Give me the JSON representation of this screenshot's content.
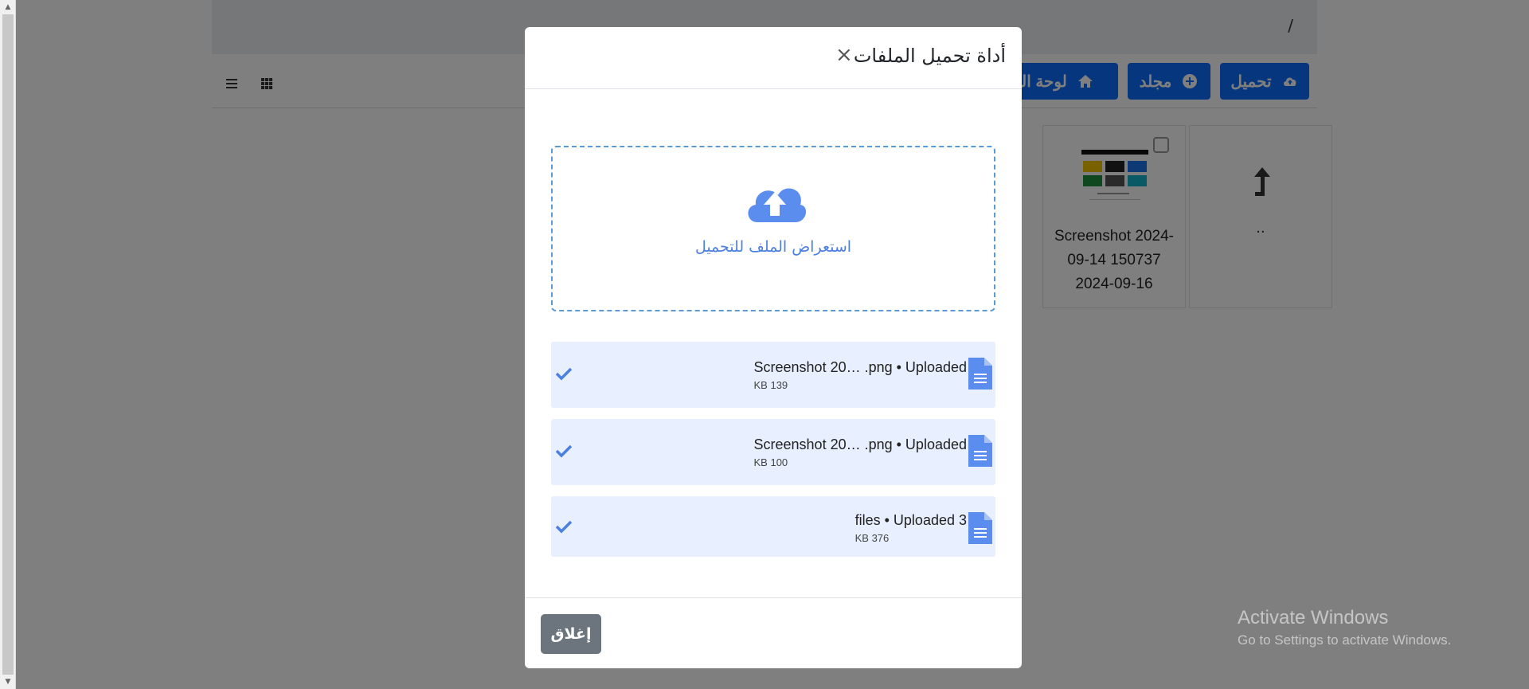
{
  "breadcrumb": {
    "separator": "/"
  },
  "toolbar": {
    "upload_label": "تحميل",
    "folder_label": "مجلد",
    "dashboard_label": "لوحة التح"
  },
  "grid": {
    "parent_label": "..",
    "file_name_line1": "Screenshot 2024-",
    "file_name_line2": "09-14 150737",
    "file_date": "2024-09-16"
  },
  "modal": {
    "title": "أداة تحميل الملفات",
    "close_x": "×",
    "dropzone_label": "استعراض الملف للتحميل",
    "files": [
      {
        "name": "Screenshot 20… .png • Uploaded",
        "size": "KB 139"
      },
      {
        "name": "Screenshot 20… .png • Uploaded",
        "size": "KB 100"
      },
      {
        "name": "files • Uploaded 3",
        "size": "KB 376"
      }
    ],
    "close_button": "إغلاق"
  },
  "watermark": {
    "line1": "Activate Windows",
    "line2": "Go to Settings to activate Windows."
  },
  "colors": {
    "primary": "#0d6efd",
    "secondary": "#6c757d",
    "dropzone_accent": "#4b7fe0",
    "file_row_bg": "#e8efff"
  },
  "icons": [
    "cloud-upload-icon",
    "plus-circle-icon",
    "home-icon",
    "list-view-icon",
    "grid-view-icon",
    "level-up-icon",
    "check-icon",
    "document-icon"
  ]
}
